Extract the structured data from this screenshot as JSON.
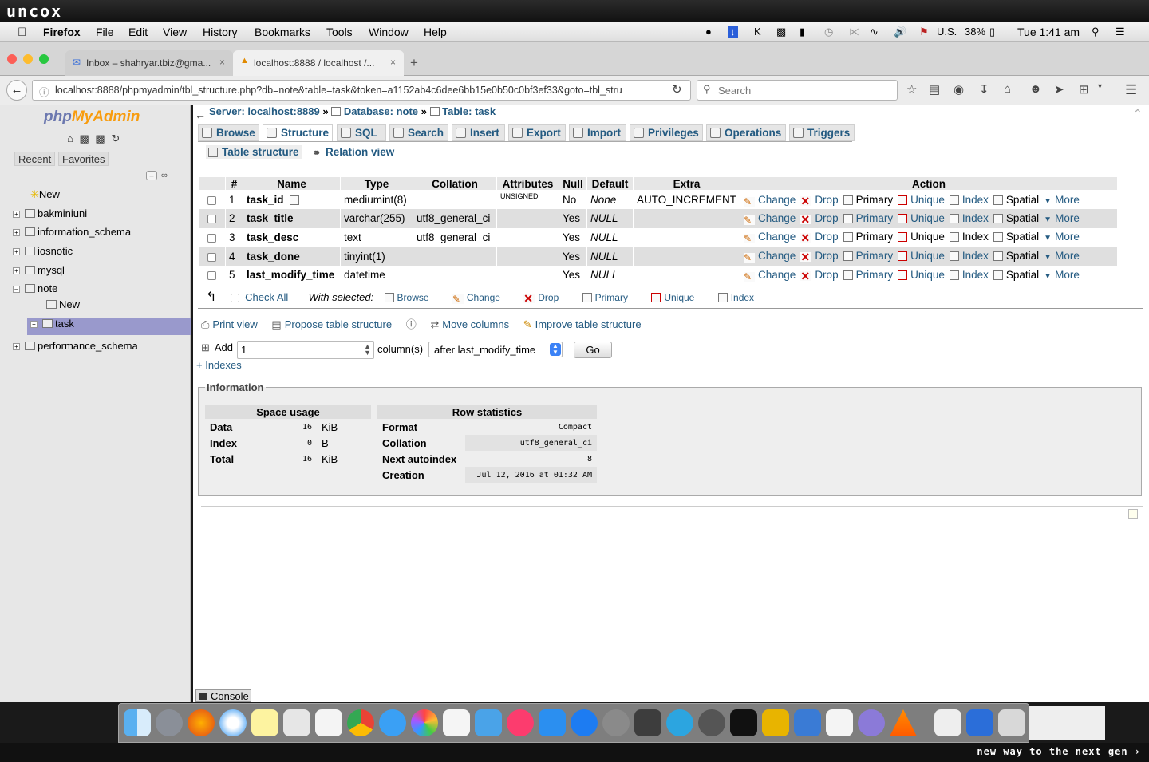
{
  "overlay": {
    "top_brand": "uncox",
    "bottom_slogan": "new way to the next gen ›"
  },
  "mac_menu": {
    "items": [
      "Firefox",
      "File",
      "Edit",
      "View",
      "History",
      "Bookmarks",
      "Tools",
      "Window",
      "Help"
    ],
    "status": {
      "lang": "U.S.",
      "battery": "38%",
      "clock": "Tue 1:41 am"
    }
  },
  "browser": {
    "tabs": [
      {
        "label": "Inbox – shahryar.tbiz@gma..."
      },
      {
        "label": "localhost:8888 / localhost /..."
      }
    ],
    "url": "localhost:8888/phpmyadmin/tbl_structure.php?db=note&table=task&token=a1152ab4c6dee6bb15e0b50c0bf3ef33&goto=tbl_stru",
    "search_placeholder": "Search"
  },
  "sidebar": {
    "logo_php": "php",
    "logo_myadmin": "MyAdmin",
    "recent": "Recent",
    "favorites": "Favorites",
    "tree": [
      "New",
      "bakminiuni",
      "information_schema",
      "iosnotic",
      "mysql",
      "note",
      "New",
      "task",
      "performance_schema"
    ]
  },
  "breadcrumb": {
    "server": "Server: localhost:8889",
    "sep": "»",
    "database": "Database: note",
    "table": "Table: task"
  },
  "tabs": [
    "Browse",
    "Structure",
    "SQL",
    "Search",
    "Insert",
    "Export",
    "Import",
    "Privileges",
    "Operations",
    "Triggers"
  ],
  "subtabs": [
    "Table structure",
    "Relation view"
  ],
  "structure": {
    "headers": [
      "#",
      "Name",
      "Type",
      "Collation",
      "Attributes",
      "Null",
      "Default",
      "Extra",
      "Action"
    ],
    "rows": [
      {
        "num": "1",
        "name": "task_id",
        "type": "mediumint(8)",
        "collation": "",
        "attributes": "UNSIGNED",
        "null": "No",
        "default": "None",
        "extra": "AUTO_INCREMENT"
      },
      {
        "num": "2",
        "name": "task_title",
        "type": "varchar(255)",
        "collation": "utf8_general_ci",
        "attributes": "",
        "null": "Yes",
        "default": "NULL",
        "extra": ""
      },
      {
        "num": "3",
        "name": "task_desc",
        "type": "text",
        "collation": "utf8_general_ci",
        "attributes": "",
        "null": "Yes",
        "default": "NULL",
        "extra": ""
      },
      {
        "num": "4",
        "name": "task_done",
        "type": "tinyint(1)",
        "collation": "",
        "attributes": "",
        "null": "Yes",
        "default": "NULL",
        "extra": ""
      },
      {
        "num": "5",
        "name": "last_modify_time",
        "type": "datetime",
        "collation": "",
        "attributes": "",
        "null": "Yes",
        "default": "NULL",
        "extra": ""
      }
    ],
    "actions": [
      "Change",
      "Drop",
      "Primary",
      "Unique",
      "Index",
      "Spatial",
      "More"
    ]
  },
  "with_selected": {
    "check_all": "Check All",
    "label": "With selected:",
    "actions": [
      "Browse",
      "Change",
      "Drop",
      "Primary",
      "Unique",
      "Index"
    ]
  },
  "table_links": [
    "Print view",
    "Propose table structure",
    "Move columns",
    "Improve table structure"
  ],
  "add_columns": {
    "label": "Add",
    "value": "1",
    "columns_label": "column(s)",
    "position": "after last_modify_time",
    "go": "Go",
    "indexes_link": "+ Indexes"
  },
  "information": {
    "legend": "Information",
    "space_usage": {
      "title": "Space usage",
      "rows": [
        {
          "label": "Data",
          "value": "16",
          "unit": "KiB"
        },
        {
          "label": "Index",
          "value": "0",
          "unit": "B"
        },
        {
          "label": "Total",
          "value": "16",
          "unit": "KiB"
        }
      ]
    },
    "row_statistics": {
      "title": "Row statistics",
      "rows": [
        {
          "label": "Format",
          "value": "Compact"
        },
        {
          "label": "Collation",
          "value": "utf8_general_ci"
        },
        {
          "label": "Next autoindex",
          "value": "8"
        },
        {
          "label": "Creation",
          "value": "Jul 12, 2016 at 01:32 AM"
        }
      ]
    }
  },
  "console": "Console",
  "colors": {
    "link": "#235a81",
    "selected_tree": "#9999cc",
    "logo_orange": "#f89c0e",
    "logo_blue": "#6c78af"
  }
}
